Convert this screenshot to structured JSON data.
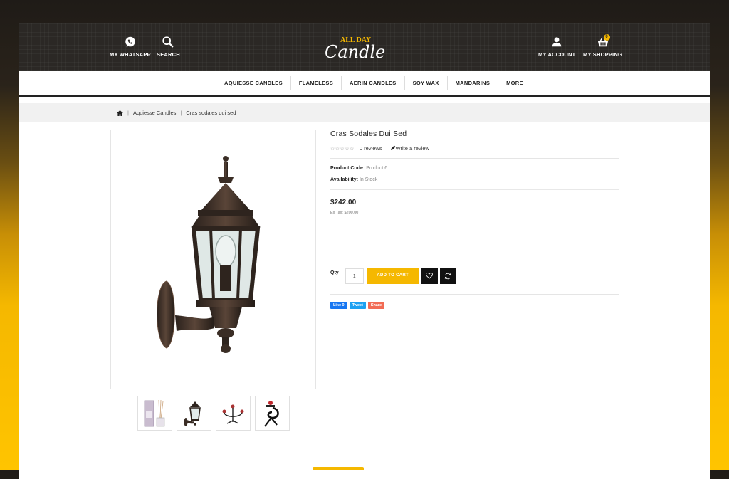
{
  "header": {
    "whatsapp_label": "MY WHATSAPP",
    "search_label": "SEARCH",
    "logo_text_top": "ALL DAY",
    "logo_text_main": "Candle",
    "account_label": "MY ACCOUNT",
    "shopping_label": "MY SHOPPING",
    "cart_count": "0"
  },
  "nav": {
    "items": [
      "AQUIESSE CANDLES",
      "FLAMELESS",
      "AERIN CANDLES",
      "SOY WAX",
      "MANDARINS",
      "MORE"
    ]
  },
  "breadcrumb": {
    "category": "Aquiesse Candles",
    "current": "Cras sodales dui sed"
  },
  "product": {
    "title": "Cras Sodales Dui Sed",
    "stars": "☆☆☆☆☆",
    "reviews": "0 reviews",
    "write_review": "Write a review",
    "code_label": "Product Code:",
    "code_value": "Product 6",
    "avail_label": "Availability:",
    "avail_value": "In Stock",
    "price": "$242.00",
    "ex_tax": "Ex Tax: $200.00",
    "qty_label": "Qty",
    "qty_value": "1",
    "add_to_cart": "ADD TO CART"
  },
  "share": {
    "like": "Like 0",
    "tweet": "Tweet",
    "share": "Share"
  },
  "colors": {
    "accent": "#f5b800",
    "dark": "#2b2825"
  }
}
